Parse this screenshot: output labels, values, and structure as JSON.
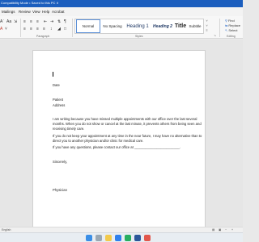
{
  "window": {
    "title": "Compatibility Mode • Saved to this PC ∨"
  },
  "menu": {
    "tabs": [
      "Mailings",
      "Review",
      "View",
      "Help",
      "Acrobat"
    ]
  },
  "ribbon": {
    "paragraph_group_label": "Paragraph",
    "styles_group_label": "Styles",
    "editing_group_label": "Editing",
    "styles": [
      {
        "label": "Normal"
      },
      {
        "label": "No Spacing"
      },
      {
        "label": "Heading 1"
      },
      {
        "label": "Heading 2"
      },
      {
        "label": "Title"
      },
      {
        "label": "Subtitle"
      }
    ],
    "editing": {
      "find_label": "Find",
      "replace_label": "Replace",
      "select_label": "Select"
    },
    "left_labels": {
      "change_case": "Aa",
      "font_color": "A"
    }
  },
  "document": {
    "lines": [
      "Date",
      "Patient",
      "Address",
      "I am writing because you have missed multiple appointments with our office over the last several",
      "months.  When you do not show or cancel at the last minute, it prevents others from being seen and",
      "receiving timely care.",
      "If you do not keep your appointment at any time in the near future, I may have no alternative than to",
      "direct you to another physician and/or clinic for medical care.",
      "If you have any questions, please contact our office at ________________________.",
      "Sincerely,",
      "Physician"
    ]
  },
  "statusbar": {
    "page_label": "English"
  },
  "colors": {
    "titlebar": "#1b5ebe",
    "accent": "#2b6bc8",
    "taskbar": "#e8edf2"
  }
}
